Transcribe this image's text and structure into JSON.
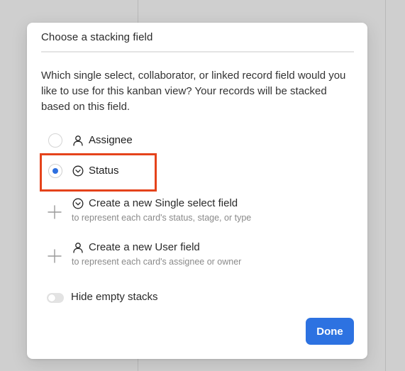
{
  "dialog": {
    "title": "Choose a stacking field",
    "description": "Which single select, collaborator, or linked record field would you like to use for this kanban view? Your records will be stacked based on this field."
  },
  "options": [
    {
      "label": "Assignee",
      "icon": "user-icon",
      "selected": false
    },
    {
      "label": "Status",
      "icon": "chevron-down-circle-icon",
      "selected": true
    }
  ],
  "create_options": [
    {
      "label": "Create a new Single select field",
      "sublabel": "to represent each card's status, stage, or type",
      "icon": "chevron-down-circle-icon"
    },
    {
      "label": "Create a new User field",
      "sublabel": "to represent each card's assignee or owner",
      "icon": "user-icon"
    }
  ],
  "hide_empty": {
    "label": "Hide empty stacks",
    "enabled": false
  },
  "done_label": "Done",
  "colors": {
    "accent": "#2d72e1",
    "highlight": "#e5431b"
  }
}
